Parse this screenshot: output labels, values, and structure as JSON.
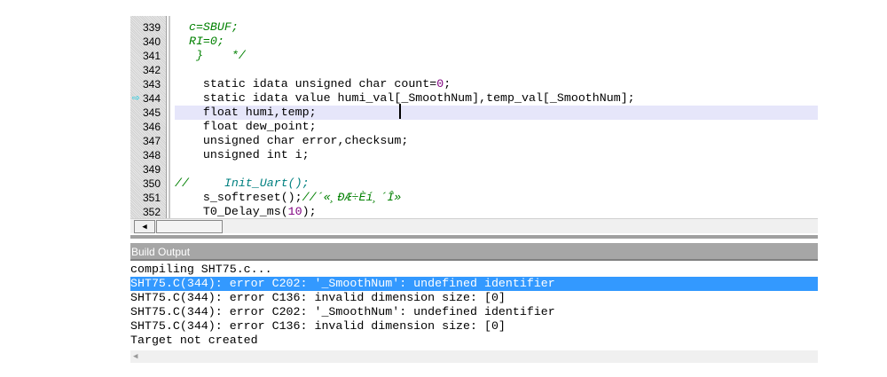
{
  "editor": {
    "current_line": "344",
    "lines": [
      {
        "n": "339",
        "segs": [
          [
            "com",
            "  c=SBUF;"
          ]
        ]
      },
      {
        "n": "340",
        "segs": [
          [
            "com",
            "  RI=0;"
          ]
        ]
      },
      {
        "n": "341",
        "segs": [
          [
            "com",
            "   }    */"
          ]
        ]
      },
      {
        "n": "342",
        "segs": []
      },
      {
        "n": "343",
        "segs": [
          [
            "p",
            "    static idata unsigned char count="
          ],
          [
            "num",
            "0"
          ],
          [
            "p",
            ";"
          ]
        ]
      },
      {
        "n": "344",
        "segs": [
          [
            "p",
            "    static idata value humi_val[_SmoothNum],temp_val[_SmoothNum];"
          ]
        ]
      },
      {
        "n": "345",
        "segs": [
          [
            "p",
            "    float humi,temp;"
          ]
        ]
      },
      {
        "n": "346",
        "segs": [
          [
            "p",
            "    float dew_point;"
          ]
        ]
      },
      {
        "n": "347",
        "segs": [
          [
            "p",
            "    unsigned char error,checksum;"
          ]
        ]
      },
      {
        "n": "348",
        "segs": [
          [
            "p",
            "    unsigned int i;"
          ]
        ]
      },
      {
        "n": "349",
        "segs": []
      },
      {
        "n": "350",
        "segs": [
          [
            "com",
            "//"
          ],
          [
            "teal",
            "     Init_Uart();"
          ]
        ]
      },
      {
        "n": "351",
        "segs": [
          [
            "p",
            "    s_softreset();"
          ],
          [
            "com",
            "//´«¸ÐÆ÷Èí¸´Î»"
          ]
        ]
      },
      {
        "n": "352",
        "segs": [
          [
            "p",
            "    T0_Delay_ms("
          ],
          [
            "num",
            "10"
          ],
          [
            "p",
            ");"
          ]
        ]
      }
    ]
  },
  "build_output": {
    "title": "Build Output",
    "lines": [
      "compiling SHT75.c...",
      "SHT75.C(344): error C202: '_SmoothNum': undefined identifier",
      "SHT75.C(344): error C136: invalid dimension size: [0]",
      "SHT75.C(344): error C202: '_SmoothNum': undefined identifier",
      "SHT75.C(344): error C136: invalid dimension size: [0]",
      "Target not created"
    ],
    "selected_index": 1
  },
  "colors": {
    "selection": "#3399ff",
    "current_line": "#e6e6fa",
    "arrow": "#00c8e0"
  }
}
